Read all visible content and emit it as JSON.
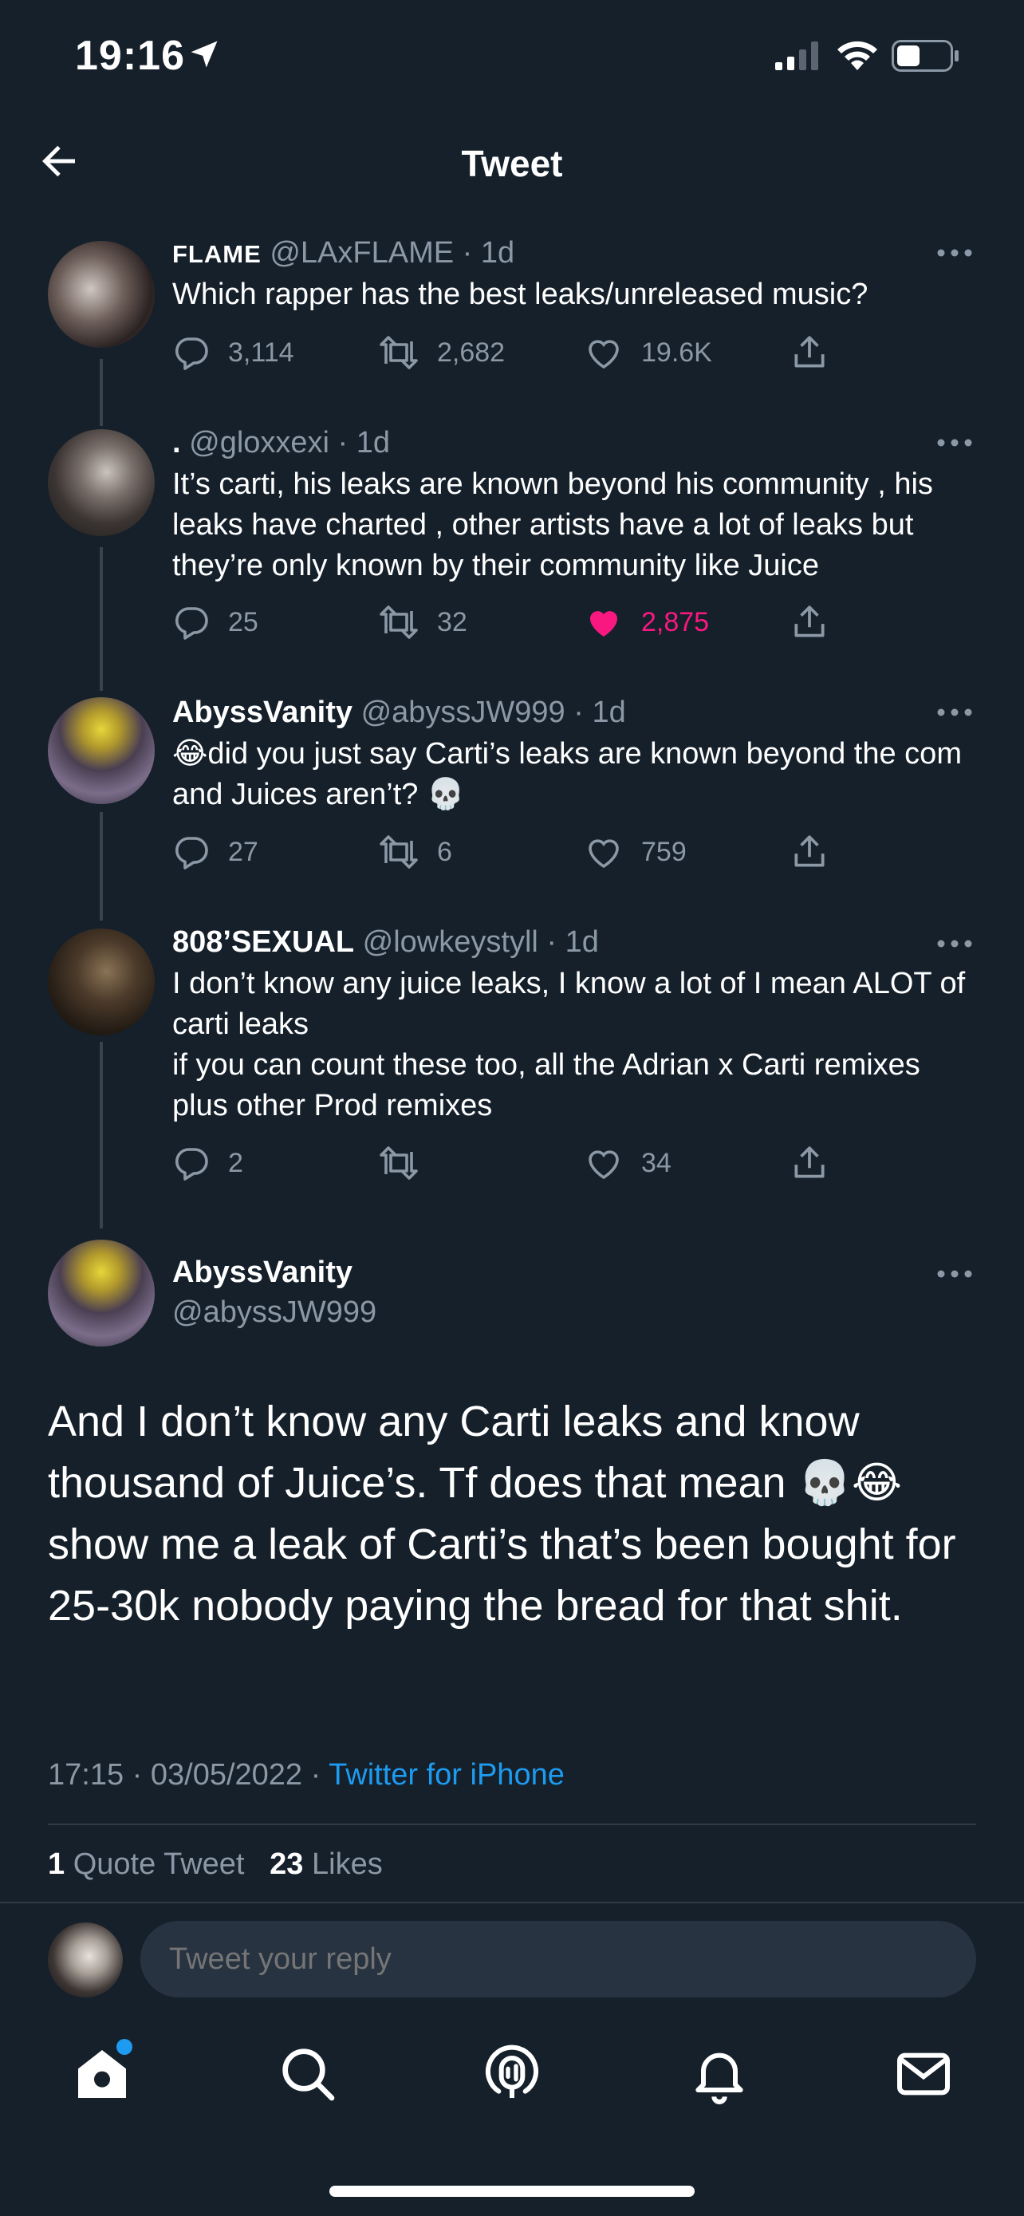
{
  "status_bar": {
    "time": "19:16"
  },
  "header": {
    "title": "Tweet"
  },
  "thread": [
    {
      "name": "FLAME",
      "handle": "@LAxFLAME",
      "age": "1d",
      "text": "Which rapper has the best leaks/unreleased music?",
      "replies": "3,114",
      "retweets": "2,682",
      "likes": "19.6K",
      "liked": false
    },
    {
      "name": ".",
      "handle": "@gloxxexi",
      "age": "1d",
      "text": "It’s carti, his leaks are known beyond his community , his leaks have charted , other artists have a lot of leaks but they’re only known by their community like Juice",
      "replies": "25",
      "retweets": "32",
      "likes": "2,875",
      "liked": true
    },
    {
      "name": "AbyssVanity",
      "handle": "@abyssJW999",
      "age": "1d",
      "text": "😂did you just say Carti’s leaks are known beyond the com and Juices aren’t? 💀",
      "replies": "27",
      "retweets": "6",
      "likes": "759",
      "liked": false
    },
    {
      "name": "808’SEXUAL",
      "handle": "@lowkeystyll",
      "age": "1d",
      "text": "I don’t know any juice leaks, I know a lot of I mean ALOT of carti leaks\nif you can count these too, all the Adrian x Carti remixes plus other Prod remixes",
      "replies": "2",
      "retweets": "",
      "likes": "34",
      "liked": false
    }
  ],
  "main_tweet": {
    "name": "AbyssVanity",
    "handle": "@abyssJW999",
    "text": "And I don’t know any Carti leaks and know thousand of Juice’s. Tf does that mean 💀😂 show me a leak of Carti’s that’s been bought for 25-30k nobody paying the bread for that shit.",
    "time": "17:15",
    "date": "03/05/2022",
    "source": "Twitter for iPhone",
    "quote_count": "1",
    "quote_label": "Quote Tweet",
    "likes_count": "23",
    "likes_label": "Likes"
  },
  "reply": {
    "placeholder": "Tweet your reply"
  },
  "tabs": [
    "home-icon",
    "search-icon",
    "spaces-icon",
    "notifications-icon",
    "messages-icon"
  ],
  "colors": {
    "background": "#15202b",
    "accent": "#1d9bf0",
    "like": "#f91880",
    "muted": "#8b98a5"
  }
}
